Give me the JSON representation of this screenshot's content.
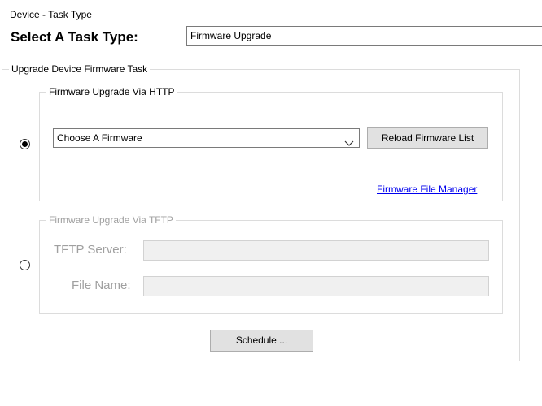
{
  "task_type_group": {
    "legend": "Device - Task Type",
    "label": "Select A Task Type:",
    "value": "Firmware Upgrade"
  },
  "upgrade_group": {
    "legend": "Upgrade Device Firmware Task",
    "http": {
      "legend": "Firmware Upgrade Via HTTP",
      "selected": true,
      "dropdown_value": "Choose A Firmware",
      "reload_label": "Reload Firmware List",
      "file_manager_link": "Firmware File Manager"
    },
    "tftp": {
      "legend": "Firmware Upgrade Via TFTP",
      "selected": false,
      "server_label": "TFTP Server:",
      "server_value": "",
      "file_label": "File Name:",
      "file_value": ""
    },
    "schedule_label": "Schedule ..."
  }
}
